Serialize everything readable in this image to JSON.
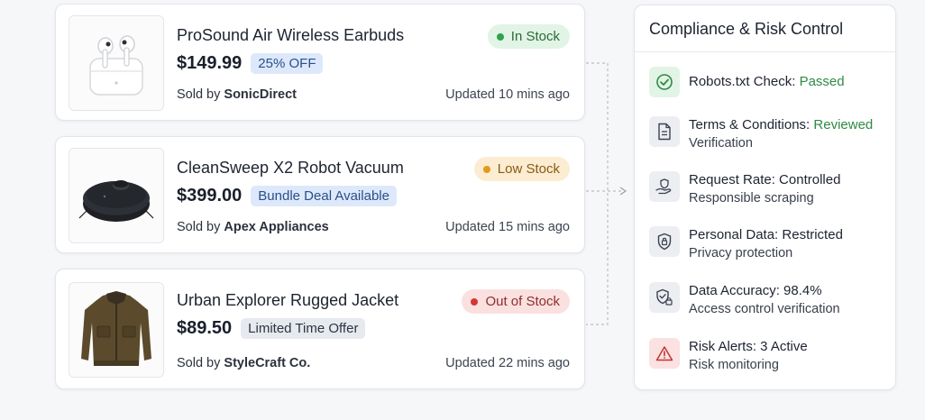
{
  "products": [
    {
      "title": "ProSound Air Wireless Earbuds",
      "price": "$149.99",
      "tag": "25% OFF",
      "seller_prefix": "Sold by ",
      "seller": "SonicDirect",
      "updated": "Updated 10 mins ago",
      "stock": "In Stock"
    },
    {
      "title": "CleanSweep X2 Robot Vacuum",
      "price": "$399.00",
      "tag": "Bundle Deal Available",
      "seller_prefix": "Sold by ",
      "seller": "Apex Appliances",
      "updated": "Updated 15 mins ago",
      "stock": "Low Stock"
    },
    {
      "title": "Urban Explorer Rugged Jacket",
      "price": "$89.50",
      "tag": "Limited Time Offer",
      "seller_prefix": "Sold by ",
      "seller": "StyleCraft Co.",
      "updated": "Updated 22 mins ago",
      "stock": "Out of Stock"
    }
  ],
  "panel": {
    "title": "Compliance & Risk Control",
    "items": [
      {
        "title": "Robots.txt Check: ",
        "status": "Passed",
        "sub": "",
        "icon": "check-circle-icon"
      },
      {
        "title": "Terms & Conditions: ",
        "status": "Reviewed",
        "sub": "Verification",
        "icon": "document-icon"
      },
      {
        "title": "Request Rate: Controlled",
        "status": "",
        "sub": "Responsible scraping",
        "icon": "hand-shield-icon"
      },
      {
        "title": "Personal Data: Restricted",
        "status": "",
        "sub": "Privacy protection",
        "icon": "lock-shield-icon"
      },
      {
        "title": "Data Accuracy: 98.4%",
        "status": "",
        "sub": "Access control verification",
        "icon": "shield-lock-icon"
      },
      {
        "title": "Risk Alerts: 3 Active",
        "status": "",
        "sub": "Risk monitoring",
        "icon": "warning-icon"
      }
    ]
  },
  "colors": {
    "in_stock": "#2fa24a",
    "low_stock": "#e09b1c",
    "out_of_stock": "#d83434",
    "passed": "#2f8a44"
  }
}
